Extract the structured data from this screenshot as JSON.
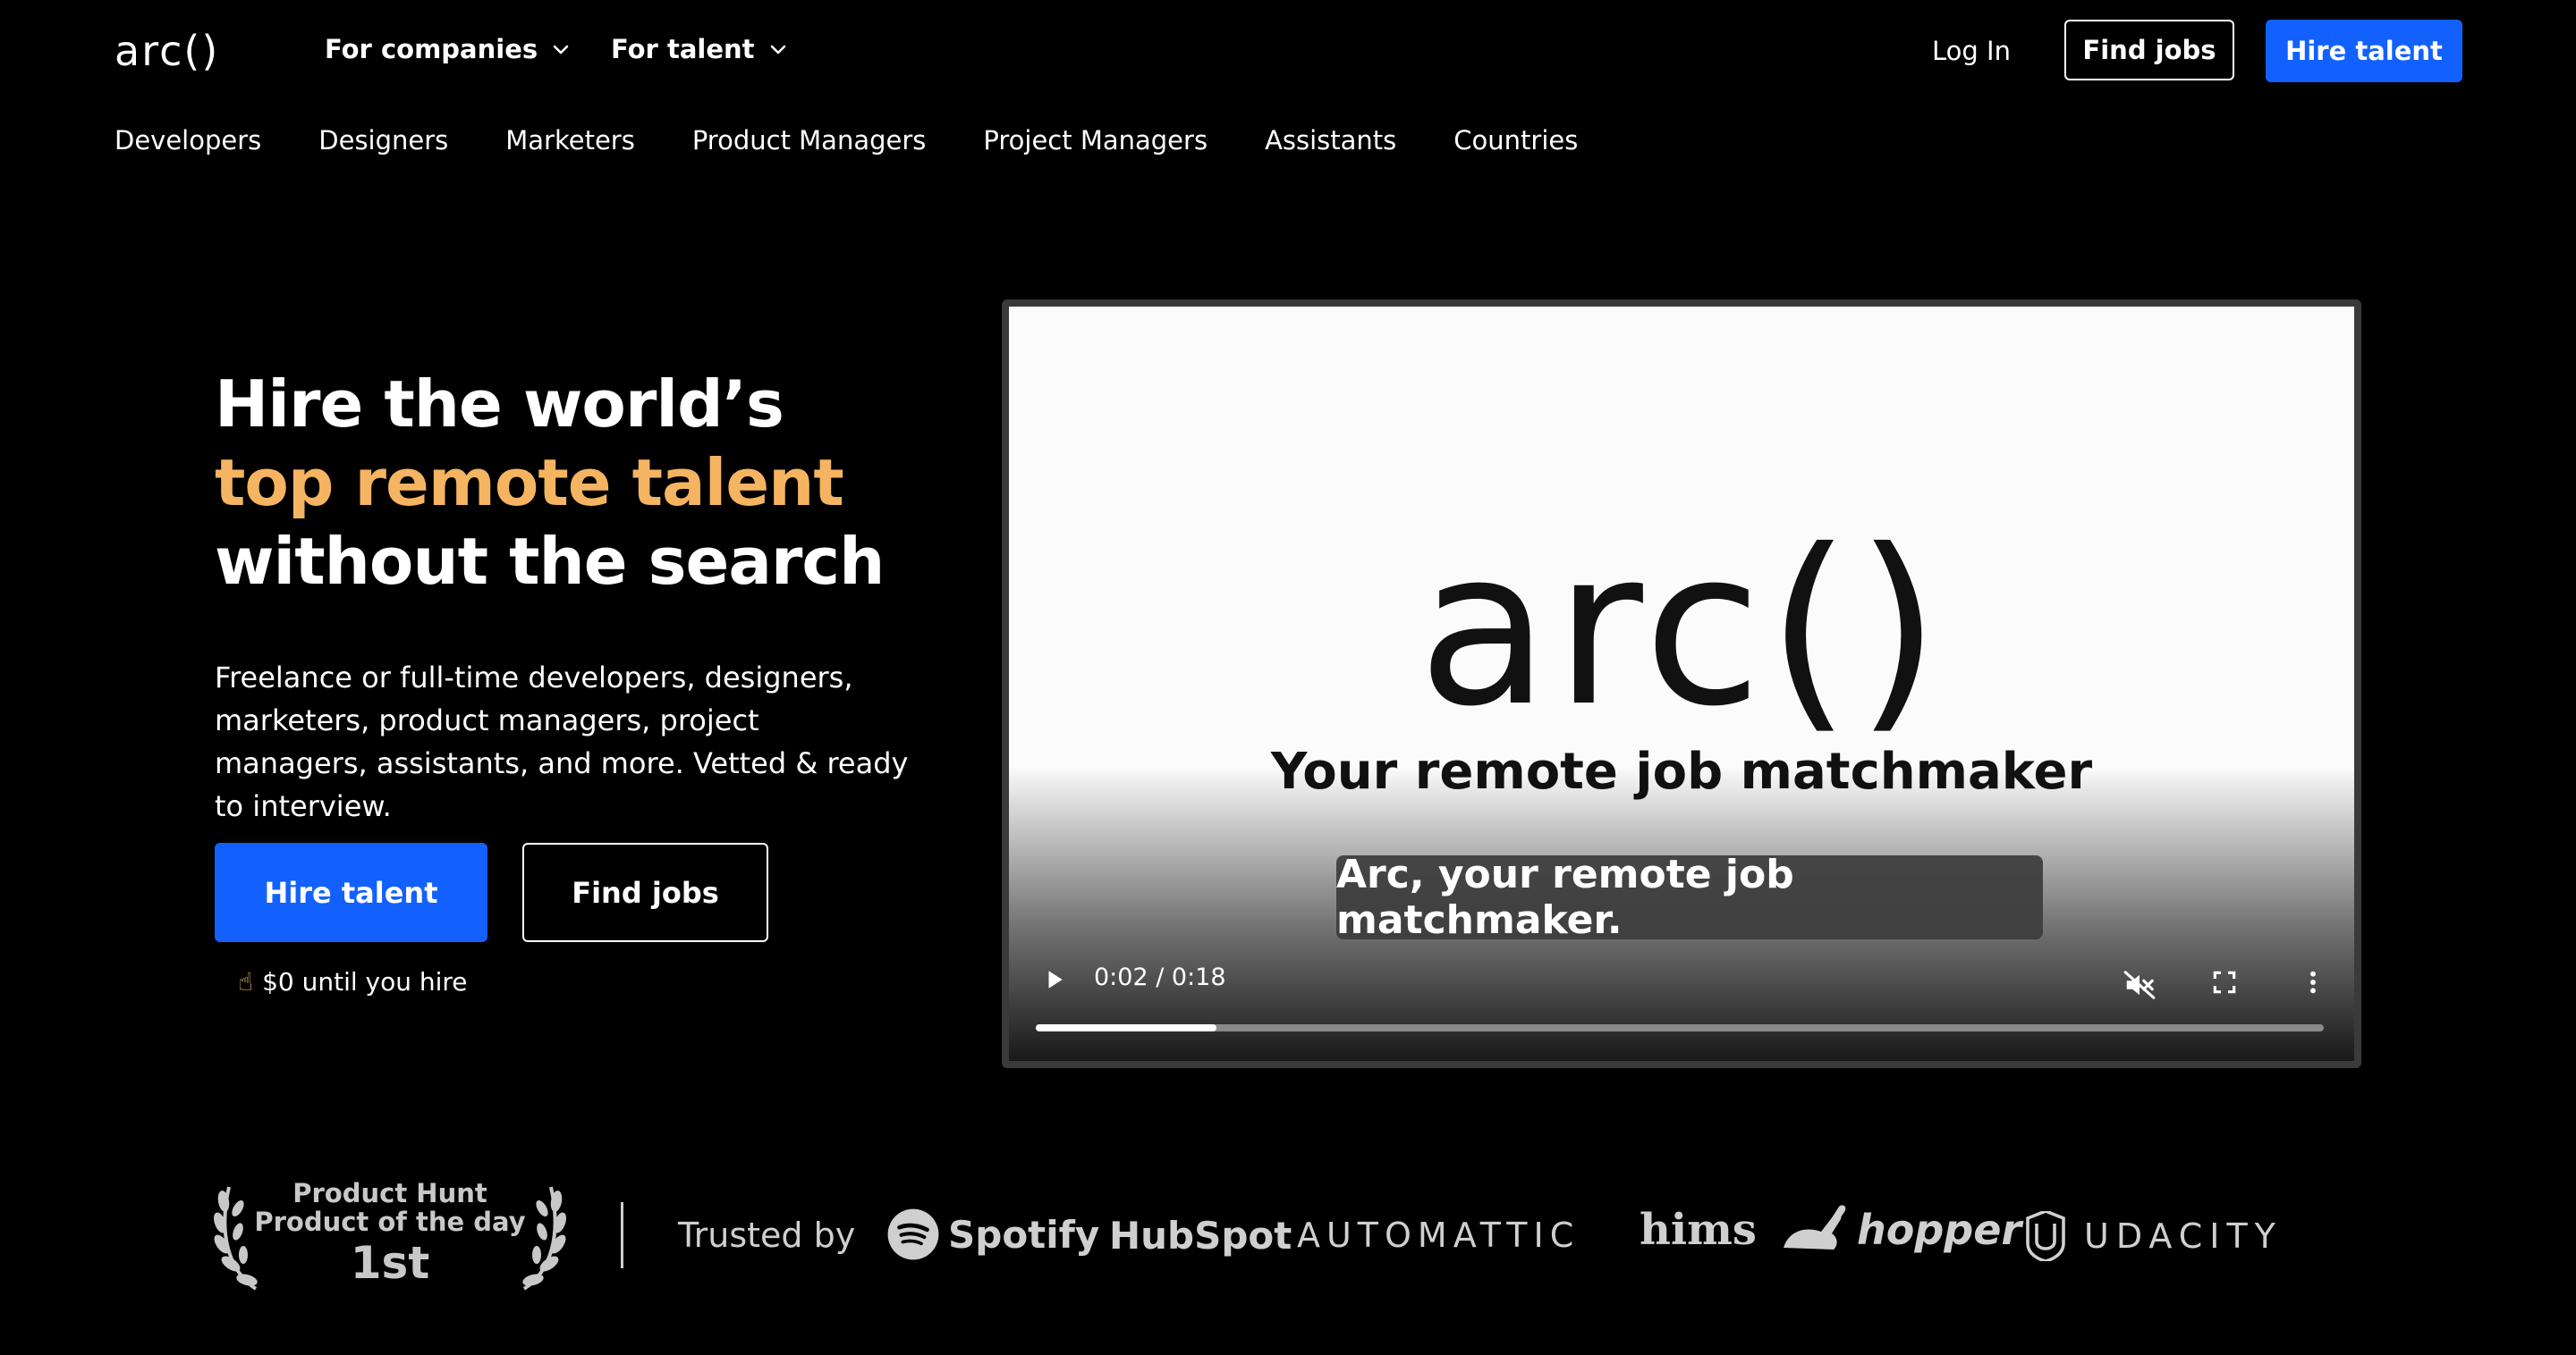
{
  "header": {
    "logo": "arc()",
    "nav_companies": "For companies",
    "nav_talent": "For talent",
    "login": "Log In",
    "find_jobs": "Find jobs",
    "hire_talent": "Hire talent"
  },
  "subnav": [
    "Developers",
    "Designers",
    "Marketers",
    "Product Managers",
    "Project Managers",
    "Assistants",
    "Countries"
  ],
  "hero": {
    "title_line1": "Hire the world’s",
    "title_line2": "top remote talent",
    "title_line3": "without the search",
    "description": "Freelance or full-time developers, designers, marketers, product managers, project managers, assistants, and more. Vetted & ready to interview.",
    "hire_button": "Hire talent",
    "find_button": "Find jobs",
    "note": "$0 until you hire"
  },
  "video": {
    "logo": "arc()",
    "tagline": "Your remote job matchmaker",
    "caption": "Arc, your remote job matchmaker.",
    "time": "0:02 / 0:18",
    "progress": 0.14
  },
  "trust": {
    "ph_line1": "Product Hunt",
    "ph_line2": "Product of the day",
    "ph_line3": "1st",
    "trusted_by": "Trusted by",
    "brands": [
      "Spotify",
      "HubSpot",
      "AUTOMATTIC",
      "hims",
      "hopper",
      "UDACITY"
    ]
  },
  "colors": {
    "accent": "#f5b461",
    "primary": "#1261ff",
    "background": "#000000"
  }
}
